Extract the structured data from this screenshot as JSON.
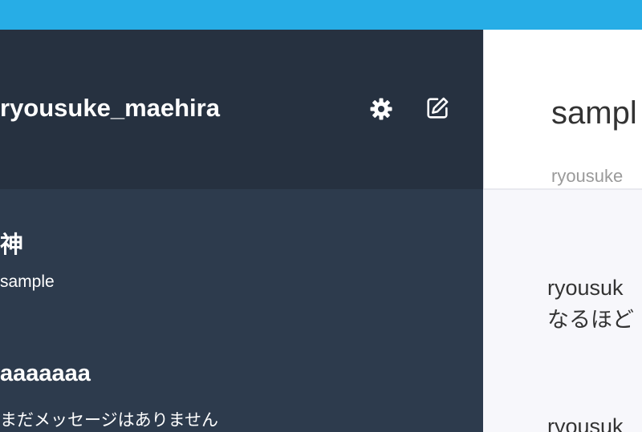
{
  "sidebar": {
    "username": "ryousuke_maehira",
    "rooms": [
      {
        "name": "神",
        "last_message": "sample"
      },
      {
        "name": "aaaaaaa",
        "last_message": "まだメッセージはありません"
      }
    ]
  },
  "main": {
    "room_title": "sampl",
    "room_owner": "ryousuke",
    "messages": [
      {
        "author": "ryousuk",
        "text": "なるほど"
      },
      {
        "author": "ryousuk",
        "text": ""
      }
    ]
  },
  "icons": {
    "settings": "gear-icon",
    "compose": "compose-icon"
  },
  "colors": {
    "topbar": "#27ade6",
    "sidebar_header": "#263140",
    "sidebar": "#2d3b4d",
    "main_bg": "#f7f7fb"
  }
}
